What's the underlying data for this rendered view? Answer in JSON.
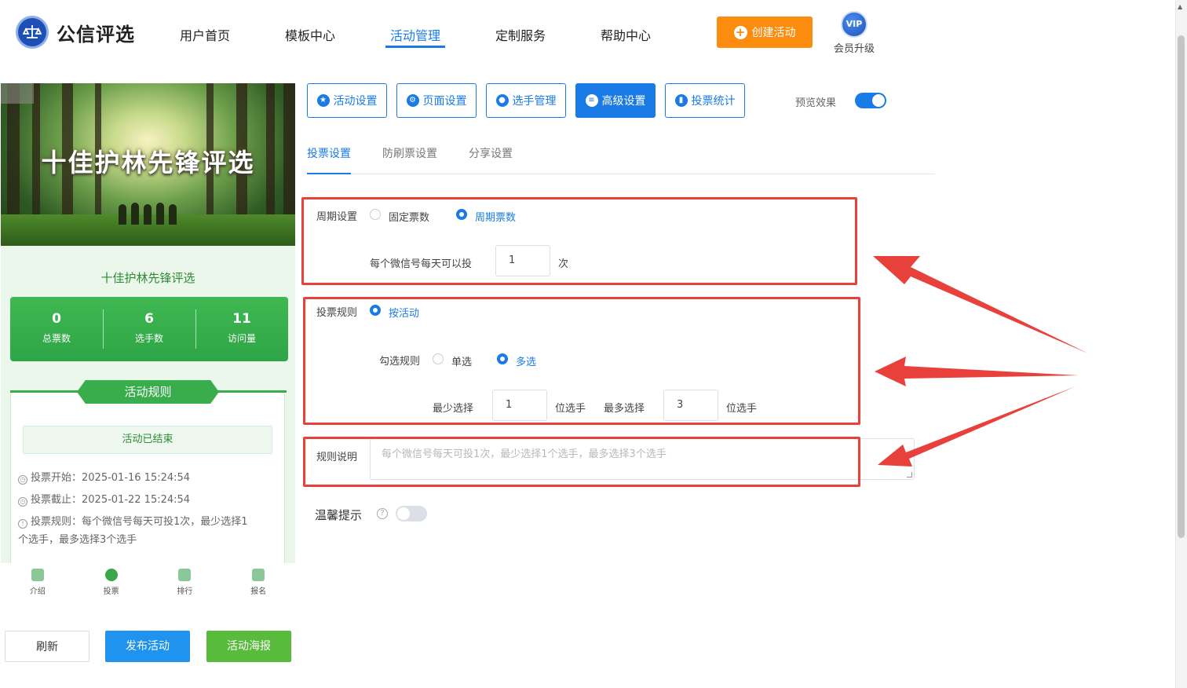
{
  "app": {
    "logo_text": "公信评选"
  },
  "nav": {
    "items": [
      "用户首页",
      "模板中心",
      "活动管理",
      "定制服务",
      "帮助中心"
    ],
    "create_label": "创建活动",
    "vip_badge": "VIP",
    "vip_label": "会员升级"
  },
  "preview": {
    "banner_title": "十佳护林先锋评选",
    "activity_name": "十佳护林先锋评选",
    "stats": [
      {
        "value": "0",
        "label": "总票数"
      },
      {
        "value": "6",
        "label": "选手数"
      },
      {
        "value": "11",
        "label": "访问量"
      }
    ],
    "rules_title": "活动规则",
    "status": "活动已结束",
    "info": {
      "start": "投票开始：2025-01-16 15:24:54",
      "end": "投票截止：2025-01-22 15:24:54",
      "rule": "投票规则：每个微信号每天可投1次，最少选择1个选手，最多选择3个选手"
    },
    "tabs": [
      "介绍",
      "投票",
      "排行",
      "报名"
    ]
  },
  "actions": {
    "refresh": "刷新",
    "publish": "发布活动",
    "poster": "活动海报"
  },
  "toolbar": {
    "buttons": [
      "活动设置",
      "页面设置",
      "选手管理",
      "高级设置",
      "投票统计"
    ],
    "preview_label": "预览效果"
  },
  "subtabs": [
    "投票设置",
    "防刷票设置",
    "分享设置"
  ],
  "settings": {
    "period_label": "周期设置",
    "period_options": [
      "固定票数",
      "周期票数"
    ],
    "per_day_label": "每个微信号每天可以投",
    "per_day_value": "1",
    "per_day_unit": "次",
    "rule_label": "投票规则",
    "rule_option": "按活动",
    "select_rule_label": "勾选规则",
    "select_options": [
      "单选",
      "多选"
    ],
    "min_label": "最少选择",
    "min_value": "1",
    "min_unit": "位选手",
    "max_label": "最多选择",
    "max_value": "3",
    "max_unit": "位选手",
    "desc_label": "规则说明",
    "desc_placeholder": "每个微信号每天可投1次，最少选择1个选手，最多选择3个选手",
    "tip_label": "温馨提示"
  },
  "colors": {
    "accent": "#1a7be6",
    "orange": "#fb8c0e",
    "green": "#39ad4b",
    "annotation": "#e8403a"
  }
}
